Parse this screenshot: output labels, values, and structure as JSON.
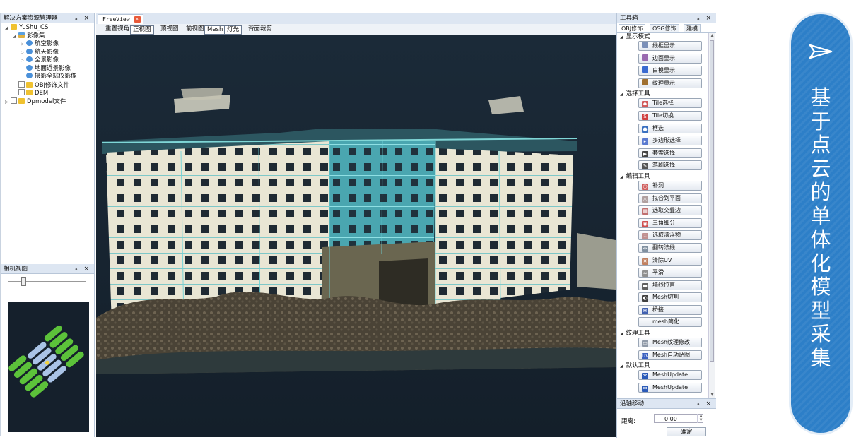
{
  "resource_panel": {
    "title": "解决方案资源管理器",
    "controls": "ₐ ×",
    "tree": [
      {
        "label": "YuShu_CS",
        "depth": 0,
        "toggle": "◢",
        "icon": "folder",
        "checkbox": false
      },
      {
        "label": "影像集",
        "depth": 1,
        "toggle": "◢",
        "icon": "stack",
        "checkbox": false
      },
      {
        "label": "航空影像",
        "depth": 2,
        "toggle": "▷",
        "icon": "img",
        "checkbox": false
      },
      {
        "label": "航天影像",
        "depth": 2,
        "toggle": "▷",
        "icon": "img",
        "checkbox": false
      },
      {
        "label": "全景影像",
        "depth": 2,
        "toggle": "▷",
        "icon": "img",
        "checkbox": false
      },
      {
        "label": "地面近景影像",
        "depth": 2,
        "toggle": "",
        "icon": "img",
        "checkbox": false
      },
      {
        "label": "摄影全站仪影像",
        "depth": 2,
        "toggle": "",
        "icon": "img",
        "checkbox": false
      },
      {
        "label": "OBJ修饰文件",
        "depth": 1,
        "toggle": "",
        "icon": "folder",
        "checkbox": true
      },
      {
        "label": "DEM",
        "depth": 1,
        "toggle": "",
        "icon": "folder",
        "checkbox": true
      },
      {
        "label": "Dpmodel文件",
        "depth": 0,
        "toggle": "▷",
        "icon": "folder",
        "checkbox": true
      }
    ]
  },
  "camera_panel": {
    "title": "相机视图",
    "controls": "ₐ ×",
    "slider_value": 0.2
  },
  "freeview": {
    "tab_label": "FreeView",
    "tab_close": "×",
    "toolbar": [
      {
        "label": "重置视角",
        "boxed": false
      },
      {
        "label": "正视图",
        "boxed": true
      },
      {
        "label": "顶视图",
        "boxed": false
      },
      {
        "label": "前视图",
        "boxed": false
      },
      {
        "label": "Mesh",
        "boxed": true
      },
      {
        "label": "灯光",
        "boxed": true
      },
      {
        "label": "背面裁剪",
        "boxed": false
      }
    ]
  },
  "toolbox": {
    "title": "工具箱",
    "controls": "ₐ ×",
    "tabs": [
      {
        "label": "OBJ修饰",
        "active": true
      },
      {
        "label": "OSG修饰",
        "active": false
      },
      {
        "label": "建模",
        "active": false
      }
    ],
    "sections": [
      {
        "title": "显示模式",
        "items": [
          {
            "label": "线框显示",
            "color": "#7a8fb8",
            "glyph": ""
          },
          {
            "label": "边面显示",
            "color": "#9a6ab0",
            "glyph": ""
          },
          {
            "label": "白模显示",
            "color": "#3a6ad0",
            "glyph": ""
          },
          {
            "label": "纹理显示",
            "color": "#a07030",
            "glyph": ""
          }
        ]
      },
      {
        "title": "选择工具",
        "items": [
          {
            "label": "Tile选择",
            "color": "#d05a5a",
            "glyph": "◆"
          },
          {
            "label": "Tile切换",
            "color": "#d04040",
            "glyph": "S"
          },
          {
            "label": "框选",
            "color": "#3a70c0",
            "glyph": "●"
          },
          {
            "label": "多边形选择",
            "color": "#5a7ad0",
            "glyph": "▸"
          },
          {
            "label": "套索选择",
            "color": "#444444",
            "glyph": "▶"
          },
          {
            "label": "笔刷选择",
            "color": "#555555",
            "glyph": "✎"
          }
        ]
      },
      {
        "title": "编辑工具",
        "items": [
          {
            "label": "补洞",
            "color": "#d06060",
            "glyph": "○"
          },
          {
            "label": "拟合到平面",
            "color": "#b0a0a0",
            "glyph": "△"
          },
          {
            "label": "选取交叠边",
            "color": "#c07070",
            "glyph": "▦"
          },
          {
            "label": "三角细分",
            "color": "#d05050",
            "glyph": "◉"
          },
          {
            "label": "选取漂浮物",
            "color": "#c09090",
            "glyph": "⁙"
          },
          {
            "label": "翻转法线",
            "color": "#8090a0",
            "glyph": "⇔"
          },
          {
            "label": "清除UV",
            "color": "#c08060",
            "glyph": "✕"
          },
          {
            "label": "平滑",
            "color": "#909090",
            "glyph": "≈"
          },
          {
            "label": "墙线拉直",
            "color": "#606060",
            "glyph": "▬"
          },
          {
            "label": "Mesh切割",
            "color": "#404040",
            "glyph": "◐"
          },
          {
            "label": "桥接",
            "color": "#4060b0",
            "glyph": "Ħ"
          },
          {
            "label": "mesh简化",
            "color": "",
            "glyph": ""
          }
        ]
      },
      {
        "title": "纹理工具",
        "items": [
          {
            "label": "Mesh纹理修改",
            "color": "#909aa8",
            "glyph": "▭"
          },
          {
            "label": "Mesh自动贴图",
            "color": "#3a60c0",
            "glyph": "UV"
          }
        ]
      },
      {
        "title": "默认工具",
        "items": [
          {
            "label": "MeshUpdate",
            "color": "#2a5ab8",
            "glyph": "✲"
          },
          {
            "label": "MeshUpdate",
            "color": "#2a5ab8",
            "glyph": "✲"
          }
        ]
      }
    ]
  },
  "axis_panel": {
    "title": "沿轴移动",
    "controls": "ₐ ×",
    "distance_label": "距离:",
    "distance_value": "0.00",
    "confirm_label": "确定"
  },
  "banner": {
    "text": "基于点云的单体化模型采集",
    "color": "#2d7fc8"
  }
}
